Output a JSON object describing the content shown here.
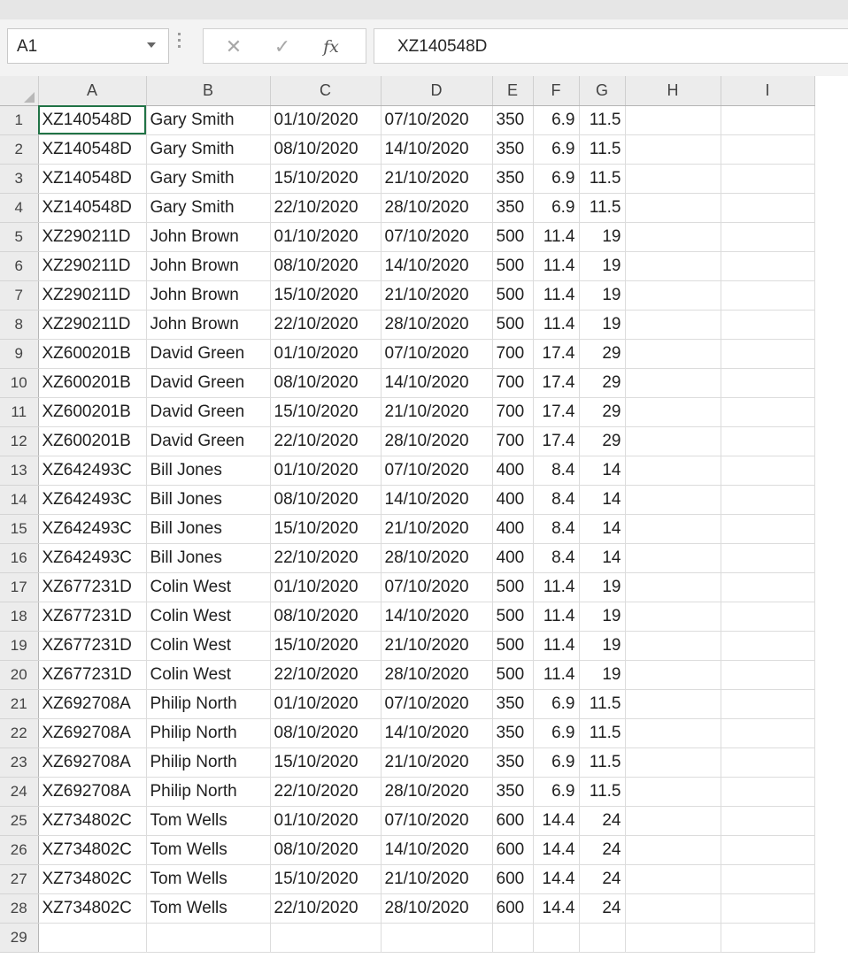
{
  "formula_bar": {
    "name_box": "A1",
    "cancel_glyph": "✕",
    "enter_glyph": "✓",
    "fx_label": "fx",
    "content": "XZ140548D"
  },
  "columns": [
    "A",
    "B",
    "C",
    "D",
    "E",
    "F",
    "G",
    "H",
    "I"
  ],
  "rows": [
    {
      "n": "1",
      "a": "XZ140548D",
      "b": "Gary Smith",
      "c": "01/10/2020",
      "d": "07/10/2020",
      "e": "350",
      "f": "6.9",
      "g": "11.5"
    },
    {
      "n": "2",
      "a": "XZ140548D",
      "b": "Gary Smith",
      "c": "08/10/2020",
      "d": "14/10/2020",
      "e": "350",
      "f": "6.9",
      "g": "11.5"
    },
    {
      "n": "3",
      "a": "XZ140548D",
      "b": "Gary Smith",
      "c": "15/10/2020",
      "d": "21/10/2020",
      "e": "350",
      "f": "6.9",
      "g": "11.5"
    },
    {
      "n": "4",
      "a": "XZ140548D",
      "b": "Gary Smith",
      "c": "22/10/2020",
      "d": "28/10/2020",
      "e": "350",
      "f": "6.9",
      "g": "11.5"
    },
    {
      "n": "5",
      "a": "XZ290211D",
      "b": "John Brown",
      "c": "01/10/2020",
      "d": "07/10/2020",
      "e": "500",
      "f": "11.4",
      "g": "19"
    },
    {
      "n": "6",
      "a": "XZ290211D",
      "b": "John Brown",
      "c": "08/10/2020",
      "d": "14/10/2020",
      "e": "500",
      "f": "11.4",
      "g": "19"
    },
    {
      "n": "7",
      "a": "XZ290211D",
      "b": "John Brown",
      "c": "15/10/2020",
      "d": "21/10/2020",
      "e": "500",
      "f": "11.4",
      "g": "19"
    },
    {
      "n": "8",
      "a": "XZ290211D",
      "b": "John Brown",
      "c": "22/10/2020",
      "d": "28/10/2020",
      "e": "500",
      "f": "11.4",
      "g": "19"
    },
    {
      "n": "9",
      "a": "XZ600201B",
      "b": "David Green",
      "c": "01/10/2020",
      "d": "07/10/2020",
      "e": "700",
      "f": "17.4",
      "g": "29"
    },
    {
      "n": "10",
      "a": "XZ600201B",
      "b": "David Green",
      "c": "08/10/2020",
      "d": "14/10/2020",
      "e": "700",
      "f": "17.4",
      "g": "29"
    },
    {
      "n": "11",
      "a": "XZ600201B",
      "b": "David Green",
      "c": "15/10/2020",
      "d": "21/10/2020",
      "e": "700",
      "f": "17.4",
      "g": "29"
    },
    {
      "n": "12",
      "a": "XZ600201B",
      "b": "David Green",
      "c": "22/10/2020",
      "d": "28/10/2020",
      "e": "700",
      "f": "17.4",
      "g": "29"
    },
    {
      "n": "13",
      "a": "XZ642493C",
      "b": "Bill Jones",
      "c": "01/10/2020",
      "d": "07/10/2020",
      "e": "400",
      "f": "8.4",
      "g": "14"
    },
    {
      "n": "14",
      "a": "XZ642493C",
      "b": "Bill Jones",
      "c": "08/10/2020",
      "d": "14/10/2020",
      "e": "400",
      "f": "8.4",
      "g": "14"
    },
    {
      "n": "15",
      "a": "XZ642493C",
      "b": "Bill Jones",
      "c": "15/10/2020",
      "d": "21/10/2020",
      "e": "400",
      "f": "8.4",
      "g": "14"
    },
    {
      "n": "16",
      "a": "XZ642493C",
      "b": "Bill Jones",
      "c": "22/10/2020",
      "d": "28/10/2020",
      "e": "400",
      "f": "8.4",
      "g": "14"
    },
    {
      "n": "17",
      "a": "XZ677231D",
      "b": "Colin West",
      "c": "01/10/2020",
      "d": "07/10/2020",
      "e": "500",
      "f": "11.4",
      "g": "19"
    },
    {
      "n": "18",
      "a": "XZ677231D",
      "b": "Colin West",
      "c": "08/10/2020",
      "d": "14/10/2020",
      "e": "500",
      "f": "11.4",
      "g": "19"
    },
    {
      "n": "19",
      "a": "XZ677231D",
      "b": "Colin West",
      "c": "15/10/2020",
      "d": "21/10/2020",
      "e": "500",
      "f": "11.4",
      "g": "19"
    },
    {
      "n": "20",
      "a": "XZ677231D",
      "b": "Colin West",
      "c": "22/10/2020",
      "d": "28/10/2020",
      "e": "500",
      "f": "11.4",
      "g": "19"
    },
    {
      "n": "21",
      "a": "XZ692708A",
      "b": "Philip North",
      "c": "01/10/2020",
      "d": "07/10/2020",
      "e": "350",
      "f": "6.9",
      "g": "11.5"
    },
    {
      "n": "22",
      "a": "XZ692708A",
      "b": "Philip North",
      "c": "08/10/2020",
      "d": "14/10/2020",
      "e": "350",
      "f": "6.9",
      "g": "11.5"
    },
    {
      "n": "23",
      "a": "XZ692708A",
      "b": "Philip North",
      "c": "15/10/2020",
      "d": "21/10/2020",
      "e": "350",
      "f": "6.9",
      "g": "11.5"
    },
    {
      "n": "24",
      "a": "XZ692708A",
      "b": "Philip North",
      "c": "22/10/2020",
      "d": "28/10/2020",
      "e": "350",
      "f": "6.9",
      "g": "11.5"
    },
    {
      "n": "25",
      "a": "XZ734802C",
      "b": "Tom Wells",
      "c": "01/10/2020",
      "d": "07/10/2020",
      "e": "600",
      "f": "14.4",
      "g": "24"
    },
    {
      "n": "26",
      "a": "XZ734802C",
      "b": "Tom Wells",
      "c": "08/10/2020",
      "d": "14/10/2020",
      "e": "600",
      "f": "14.4",
      "g": "24"
    },
    {
      "n": "27",
      "a": "XZ734802C",
      "b": "Tom Wells",
      "c": "15/10/2020",
      "d": "21/10/2020",
      "e": "600",
      "f": "14.4",
      "g": "24"
    },
    {
      "n": "28",
      "a": "XZ734802C",
      "b": "Tom Wells",
      "c": "22/10/2020",
      "d": "28/10/2020",
      "e": "600",
      "f": "14.4",
      "g": "24"
    },
    {
      "n": "29",
      "a": "",
      "b": "",
      "c": "",
      "d": "",
      "e": "",
      "f": "",
      "g": ""
    }
  ]
}
